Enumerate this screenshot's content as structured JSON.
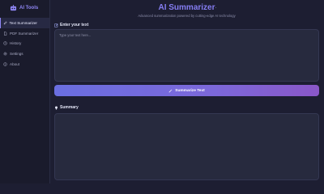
{
  "app": {
    "brand": "AI Tools",
    "brand_icon": "robot-icon",
    "accent": "#857df2"
  },
  "sidebar": {
    "items": [
      {
        "label": "Text Summarizer",
        "icon": "edit-icon",
        "active": true
      },
      {
        "label": "PDF Summarizer",
        "icon": "file-icon",
        "active": false
      },
      {
        "label": "History",
        "icon": "clock-icon",
        "active": false
      },
      {
        "label": "Settings",
        "icon": "gear-icon",
        "active": false
      },
      {
        "label": "About",
        "icon": "info-icon",
        "active": false
      }
    ]
  },
  "header": {
    "title": "AI Summarizer",
    "subtitle": "Advanced summarization powered by cutting-edge AI technology"
  },
  "input": {
    "label": "Enter your text",
    "placeholder": "Type your text here..."
  },
  "actions": {
    "summarize_label": "Summarize Text"
  },
  "summary": {
    "label": "Summary"
  }
}
